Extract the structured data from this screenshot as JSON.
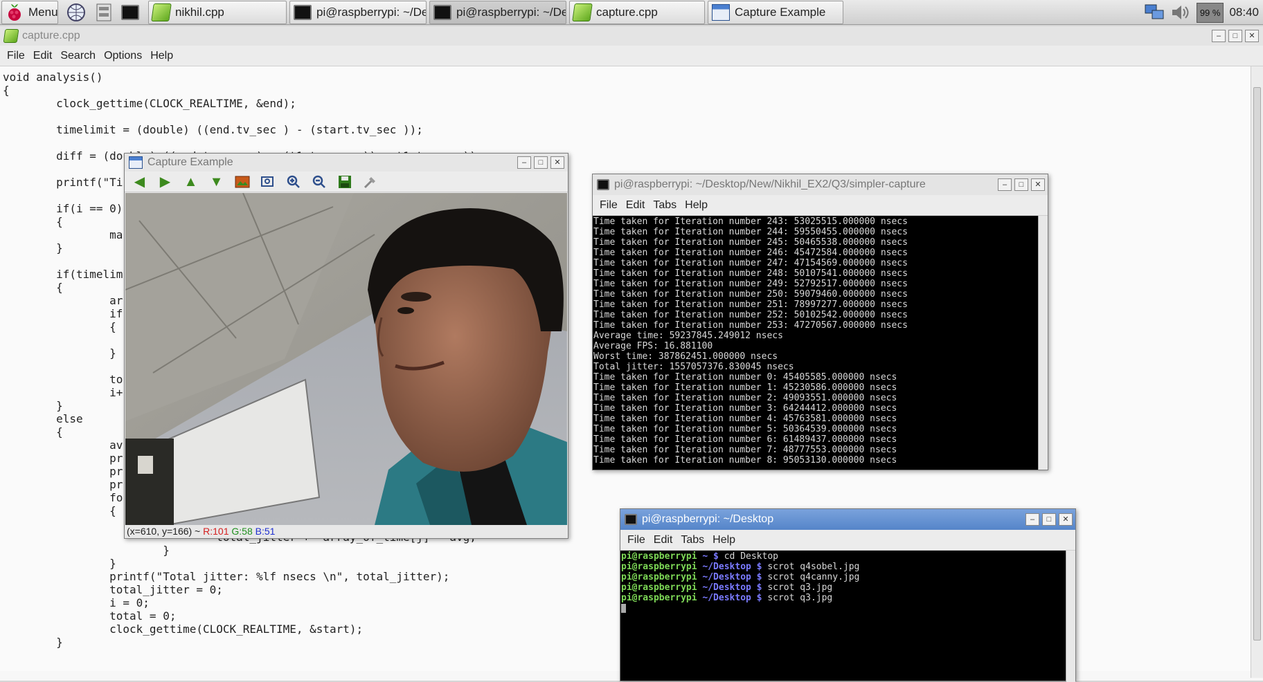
{
  "taskbar": {
    "menu_label": "Menu",
    "tasks": [
      {
        "label": "nikhil.cpp",
        "icon": "geany-editor-icon"
      },
      {
        "label": "pi@raspberrypi: ~/De...",
        "icon": "terminal-icon"
      },
      {
        "label": "pi@raspberrypi: ~/De...",
        "icon": "terminal-icon"
      },
      {
        "label": "capture.cpp",
        "icon": "geany-editor-icon"
      },
      {
        "label": "Capture Example",
        "icon": "window-icon"
      }
    ],
    "battery": "99 %",
    "clock": "08:40"
  },
  "editor": {
    "title": "capture.cpp",
    "menu": [
      "File",
      "Edit",
      "Search",
      "Options",
      "Help"
    ],
    "code": "void analysis()\n{\n        clock_gettime(CLOCK_REALTIME, &end);\n\n        timelimit = (double) ((end.tv_sec ) - (start.tv_sec ));\n\n        diff = (double) ((end.tv_nsec ) - (t1.tv_nsec )) + t1.tv_nsec));\n\n        printf(\"Ti\n\n        if(i == 0)\n        {\n                ma\n        }\n\n        if(timelim\n        {\n                ar\n                if\n                {\n\n                }\n\n                to\n                i+\n        }\n        else\n        {\n                av\n                pr\n                pr\n                pr\n                fo\n                {\n                        {\n                                total_jitter += array_of_time[j] - avg;\n                        }\n                }\n                printf(\"Total jitter: %lf nsecs \\n\", total_jitter);\n                total_jitter = 0;\n                i = 0;\n                total = 0;\n                clock_gettime(CLOCK_REALTIME, &start);\n        }"
  },
  "capture": {
    "title": "Capture Example",
    "tools": [
      "arrow-left-icon",
      "arrow-right-icon",
      "arrow-up-icon",
      "arrow-down-icon",
      "image-icon",
      "zoom-fit-icon",
      "zoom-in-icon",
      "zoom-out-icon",
      "save-icon",
      "properties-icon"
    ],
    "status_pos": "(x=610, y=166) ~ ",
    "status_r": "R:101",
    "status_g": "G:58",
    "status_b": "B:51"
  },
  "terminal1": {
    "title": "pi@raspberrypi: ~/Desktop/New/Nikhil_EX2/Q3/simpler-capture",
    "menu": [
      "File",
      "Edit",
      "Tabs",
      "Help"
    ],
    "lines": [
      "Time taken for Iteration number 243: 53025515.000000 nsecs",
      "Time taken for Iteration number 244: 59550455.000000 nsecs",
      "Time taken for Iteration number 245: 50465538.000000 nsecs",
      "Time taken for Iteration number 246: 45472584.000000 nsecs",
      "Time taken for Iteration number 247: 47154569.000000 nsecs",
      "Time taken for Iteration number 248: 50107541.000000 nsecs",
      "Time taken for Iteration number 249: 52792517.000000 nsecs",
      "Time taken for Iteration number 250: 59079460.000000 nsecs",
      "Time taken for Iteration number 251: 78997277.000000 nsecs",
      "Time taken for Iteration number 252: 50102542.000000 nsecs",
      "Time taken for Iteration number 253: 47270567.000000 nsecs",
      "Average time: 59237845.249012 nsecs",
      "Average FPS: 16.881100",
      "Worst time: 387862451.000000 nsecs",
      "Total jitter: 1557057376.830045 nsecs",
      "Time taken for Iteration number 0: 45405585.000000 nsecs",
      "Time taken for Iteration number 1: 45230586.000000 nsecs",
      "Time taken for Iteration number 2: 49093551.000000 nsecs",
      "Time taken for Iteration number 3: 64244412.000000 nsecs",
      "Time taken for Iteration number 4: 45763581.000000 nsecs",
      "Time taken for Iteration number 5: 50364539.000000 nsecs",
      "Time taken for Iteration number 6: 61489437.000000 nsecs",
      "Time taken for Iteration number 7: 48777553.000000 nsecs",
      "Time taken for Iteration number 8: 95053130.000000 nsecs"
    ]
  },
  "terminal2": {
    "title": "pi@raspberrypi: ~/Desktop",
    "menu": [
      "File",
      "Edit",
      "Tabs",
      "Help"
    ],
    "lines": [
      {
        "user": "pi@raspberrypi",
        "dir": " ~ $ ",
        "cmd": "cd Desktop"
      },
      {
        "user": "pi@raspberrypi",
        "dir": " ~/Desktop $ ",
        "cmd": "scrot q4sobel.jpg"
      },
      {
        "user": "pi@raspberrypi",
        "dir": " ~/Desktop $ ",
        "cmd": "scrot q4canny.jpg"
      },
      {
        "user": "pi@raspberrypi",
        "dir": " ~/Desktop $ ",
        "cmd": "scrot q3.jpg"
      },
      {
        "user": "pi@raspberrypi",
        "dir": " ~/Desktop $ ",
        "cmd": "scrot q3.jpg"
      }
    ]
  },
  "colors": {
    "desktop": "#d6d6d6",
    "terminal_bg": "#000000",
    "prompt_user": "#7ed957",
    "prompt_dir": "#7a7aff",
    "focused_title": "#5585c9"
  }
}
